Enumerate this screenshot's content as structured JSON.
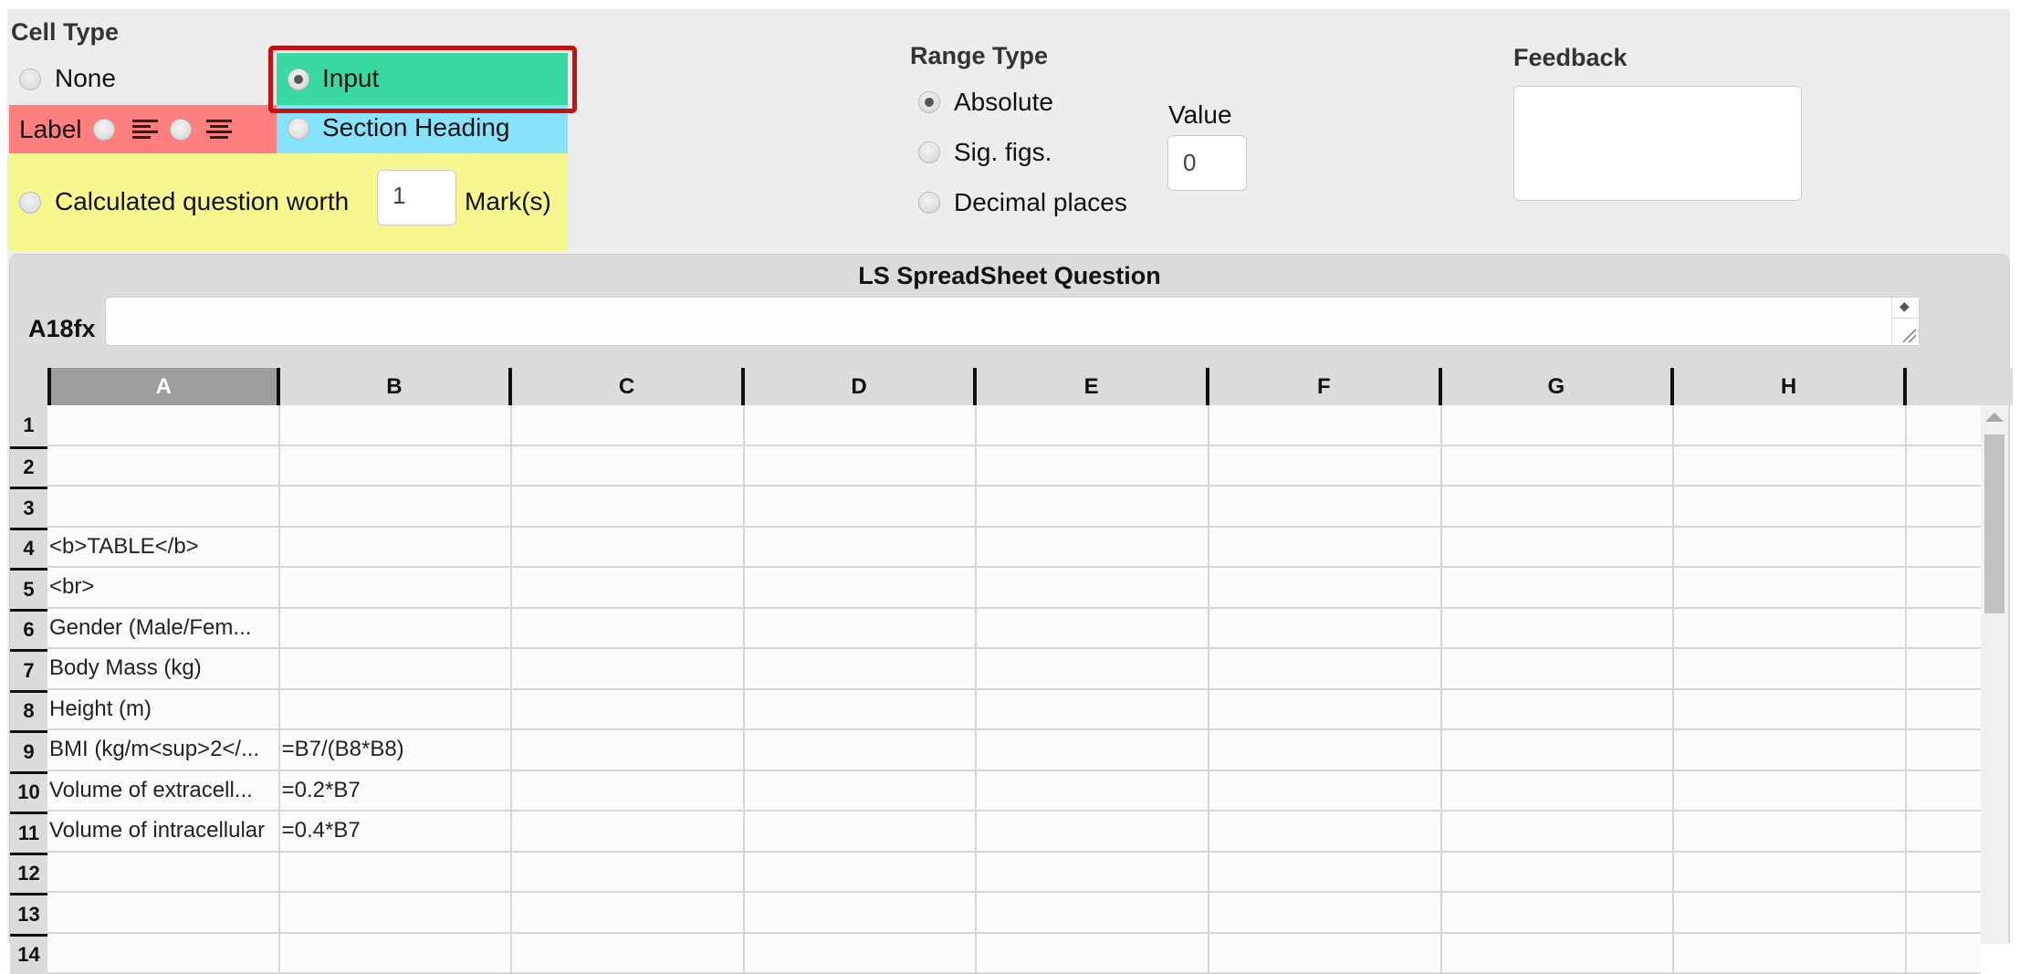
{
  "cell_type": {
    "title": "Cell Type",
    "options": {
      "none": {
        "label": "None",
        "checked": false
      },
      "input": {
        "label": "Input",
        "checked": true
      },
      "label": {
        "label": "Label",
        "align_left_checked": false,
        "align_center_checked": false
      },
      "section_heading": {
        "label": "Section Heading",
        "checked": false
      },
      "calculated": {
        "label_prefix": "Calculated question worth",
        "marks_value": "1",
        "label_suffix": "Mark(s)",
        "checked": false
      }
    },
    "icons": {
      "align_left": "align-left-icon",
      "align_center": "align-center-icon"
    }
  },
  "range_type": {
    "title": "Range Type",
    "options": [
      {
        "label": "Absolute",
        "checked": true
      },
      {
        "label": "Sig. figs.",
        "checked": false
      },
      {
        "label": "Decimal places",
        "checked": false
      }
    ],
    "value_label": "Value",
    "value": "0"
  },
  "feedback": {
    "title": "Feedback",
    "value": ""
  },
  "colors": {
    "input": "#3bd9a2",
    "label": "#ff7f7f",
    "section_heading": "#87e3fb",
    "calculated": "#f7f78f",
    "highlight": "#c81010"
  },
  "spreadsheet": {
    "title": "LS SpreadSheet Question",
    "cell_ref": "A18fx",
    "formula": "",
    "selected_column": "A",
    "columns": [
      "A",
      "B",
      "C",
      "D",
      "E",
      "F",
      "G",
      "H"
    ],
    "rows": [
      {
        "n": "1",
        "A": "",
        "B": "",
        "a_type": "",
        "b_type": ""
      },
      {
        "n": "2",
        "A": "",
        "B": "",
        "a_type": "",
        "b_type": ""
      },
      {
        "n": "3",
        "A": "",
        "B": "",
        "a_type": "",
        "b_type": ""
      },
      {
        "n": "4",
        "A": "<b>TABLE</b>",
        "B": "",
        "a_type": "section_heading",
        "b_type": ""
      },
      {
        "n": "5",
        "A": "<br>",
        "B": "",
        "a_type": "section_heading",
        "b_type": ""
      },
      {
        "n": "6",
        "A": "Gender (Male/Fem...",
        "B": "",
        "a_type": "label",
        "b_type": "input"
      },
      {
        "n": "7",
        "A": "Body Mass (kg)",
        "B": "",
        "a_type": "label",
        "b_type": "input"
      },
      {
        "n": "8",
        "A": "Height (m)",
        "B": "",
        "a_type": "label",
        "b_type": "input"
      },
      {
        "n": "9",
        "A": "BMI (kg/m<sup>2</...",
        "B": "=B7/(B8*B8)",
        "a_type": "label",
        "b_type": "calculated"
      },
      {
        "n": "10",
        "A": "Volume of extracell...",
        "B": "=0.2*B7",
        "a_type": "label",
        "b_type": "calculated"
      },
      {
        "n": "11",
        "A": "Volume of intracellular",
        "B": "=0.4*B7",
        "a_type": "label",
        "b_type": "calculated"
      },
      {
        "n": "12",
        "A": "",
        "B": "",
        "a_type": "",
        "b_type": ""
      },
      {
        "n": "13",
        "A": "",
        "B": "",
        "a_type": "",
        "b_type": ""
      },
      {
        "n": "14",
        "A": "",
        "B": "",
        "a_type": "",
        "b_type": ""
      }
    ]
  }
}
